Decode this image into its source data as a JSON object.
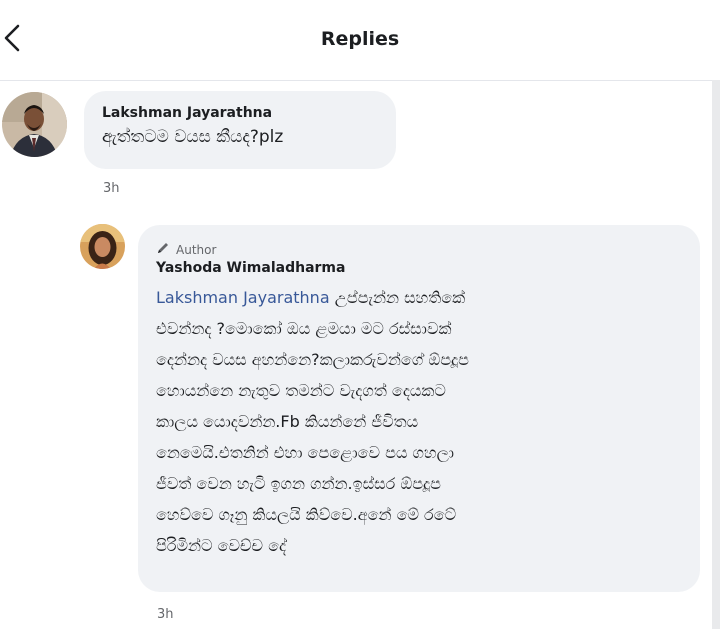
{
  "header": {
    "title": "Replies",
    "back_icon": "chevron-left-icon"
  },
  "comment": {
    "author": "Lakshman Jayarathna",
    "text": "ඇත්තටම වයස කීයද?plz",
    "time": "3h",
    "avatar_icon": "user-avatar"
  },
  "reply": {
    "badge_icon": "pencil-icon",
    "badge_label": "Author",
    "author": "Yashoda Wimaladharma",
    "mention": "Lakshman Jayarathna",
    "lines": [
      "උප්පැන්න සහතිකේ",
      "එවන්නද ?මොකෝ ඔය ළමයා මට රස්සාවක්",
      "දෙන්නද වයස අහන්නෙ?කලාකරුවන්ගේ ඕපදූප",
      "හොයන්නෙ නැතුව තමන්ට වැදගත් දෙයකට",
      "කාලය යොදවන්න.Fb කියන්නේ ජීවිතය",
      "නෙමෙයි.එතනින් එහා පෙළොවෙ පය ගහලා",
      "ජීවත් වෙන හැටි ඉගන ගන්න.ඉස්සර ඕපදූප",
      "හෙව්වෙ ගෑනු කියලයි කිව්වෙ.අනේ මේ රටේ",
      "පිරිමින්ට වෙච්ච දේ"
    ],
    "time": "3h",
    "avatar_icon": "user-avatar"
  }
}
